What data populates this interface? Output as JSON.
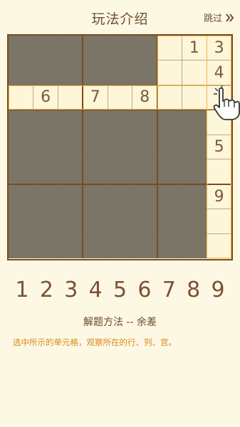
{
  "header": {
    "title": "玩法介绍",
    "skip_label": "跳过"
  },
  "board": {
    "rows": [
      [
        "",
        "",
        "",
        "",
        "",
        "",
        "",
        "1",
        "3"
      ],
      [
        "",
        "",
        "",
        "",
        "",
        "",
        "",
        "",
        "4"
      ],
      [
        "",
        "6",
        "",
        "7",
        "",
        "8",
        "",
        "",
        ""
      ],
      [
        "",
        "",
        "",
        "",
        "",
        "",
        "",
        "",
        ""
      ],
      [
        "",
        "",
        "",
        "",
        "",
        "",
        "",
        "",
        "5"
      ],
      [
        "",
        "",
        "",
        "",
        "",
        "",
        "",
        "",
        ""
      ],
      [
        "",
        "",
        "",
        "",
        "",
        "",
        "",
        "",
        "9"
      ],
      [
        "",
        "",
        "",
        "",
        "",
        "",
        "",
        "",
        ""
      ],
      [
        "",
        "",
        "",
        "",
        "",
        "",
        "",
        "",
        ""
      ]
    ],
    "selected_cell": {
      "row": 3,
      "col": 9
    },
    "colors": {
      "dim": "#7a7566",
      "highlight": "#fdf6d8",
      "accent": "#f1b64a"
    }
  },
  "numpad": [
    "1",
    "2",
    "3",
    "4",
    "5",
    "6",
    "7",
    "8",
    "9"
  ],
  "method_title": "解题方法 -- 余差",
  "description": "选中所示的单元格，观察所在的行、列、宫。"
}
